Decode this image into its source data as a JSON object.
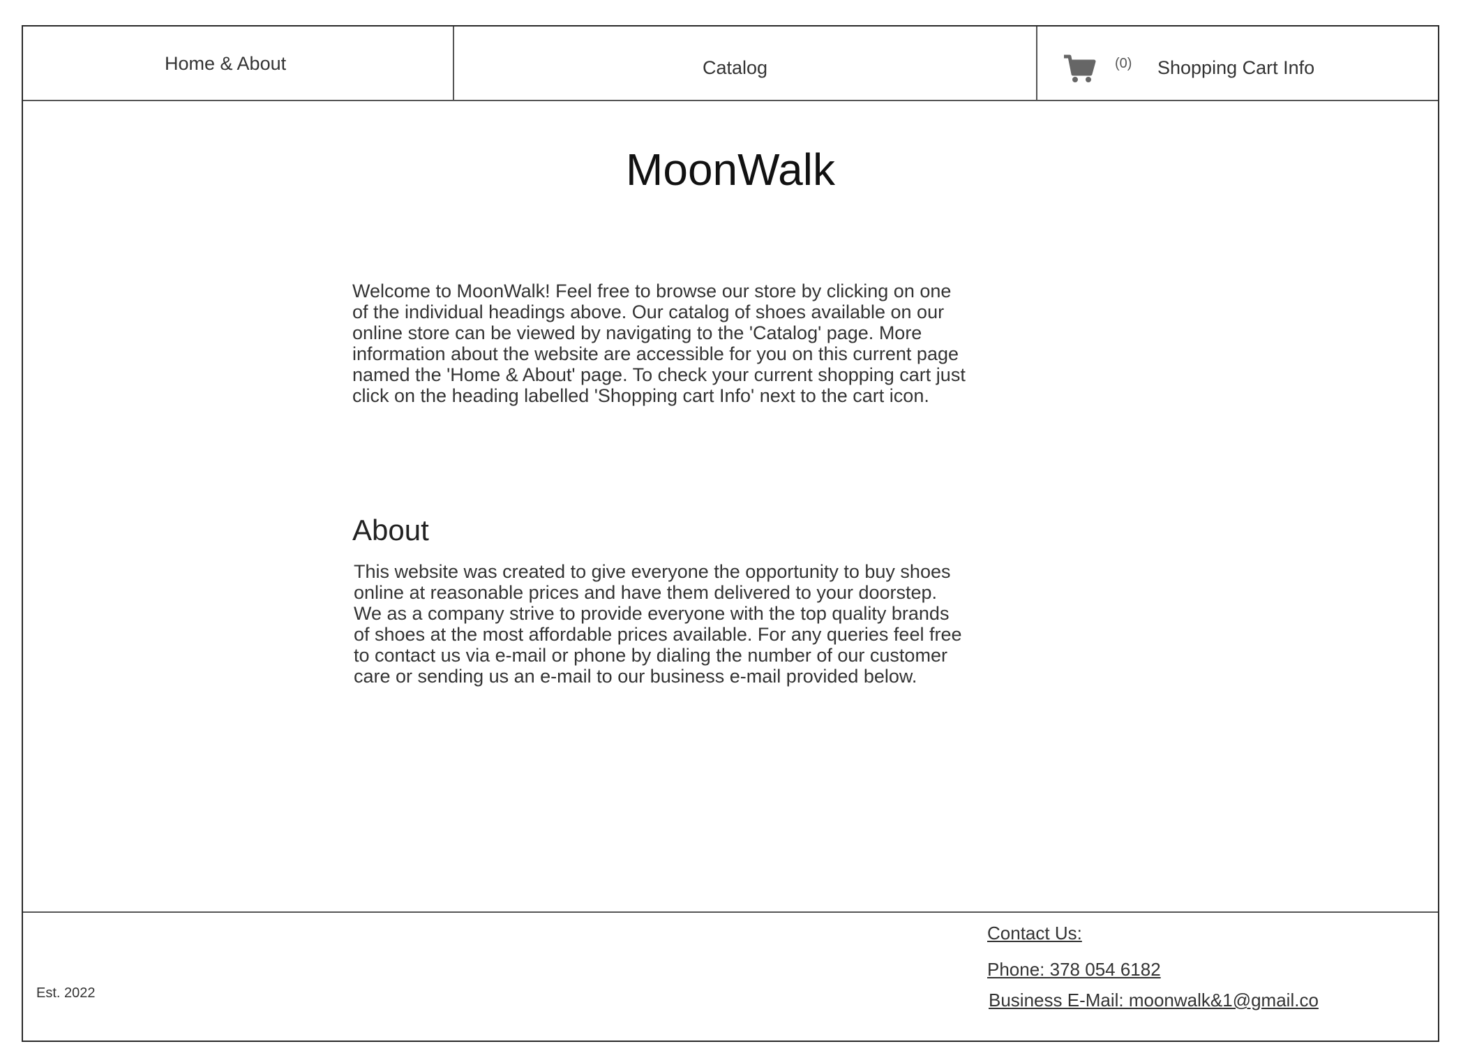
{
  "nav": {
    "home_label": "Home & About",
    "catalog_label": "Catalog",
    "cart": {
      "icon": "shopping-cart-icon",
      "count": "(0)",
      "label": "Shopping Cart Info"
    }
  },
  "main": {
    "title": "MoonWalk",
    "welcome_text": "Welcome to MoonWalk! Feel free to browse our store by clicking on one of the individual headings above. Our catalog of shoes available on our online store can be viewed by navigating to the 'Catalog' page. More information about the website are accessible for you on this current page named the 'Home & About' page. To check your current shopping cart just click on the heading labelled 'Shopping cart Info' next to the cart icon.",
    "about_heading": "About",
    "about_text": "This website was created to give everyone the opportunity to buy shoes online at reasonable prices and have them delivered to your doorstep. We as a company strive to provide everyone with the top quality brands of shoes at the most affordable prices available. For any queries feel free to contact us via e-mail or phone by dialing the number of our customer care or sending us an e-mail to our business e-mail provided below."
  },
  "footer": {
    "established": "Est. 2022",
    "contact_title": "Contact Us:",
    "phone": "Phone: 378 054 6182",
    "email": "Business E-Mail: moonwalk&1@gmail.co"
  },
  "colors": {
    "border": "#2a2a2a",
    "divider": "#555555",
    "text": "#333333",
    "icon": "#666666"
  }
}
